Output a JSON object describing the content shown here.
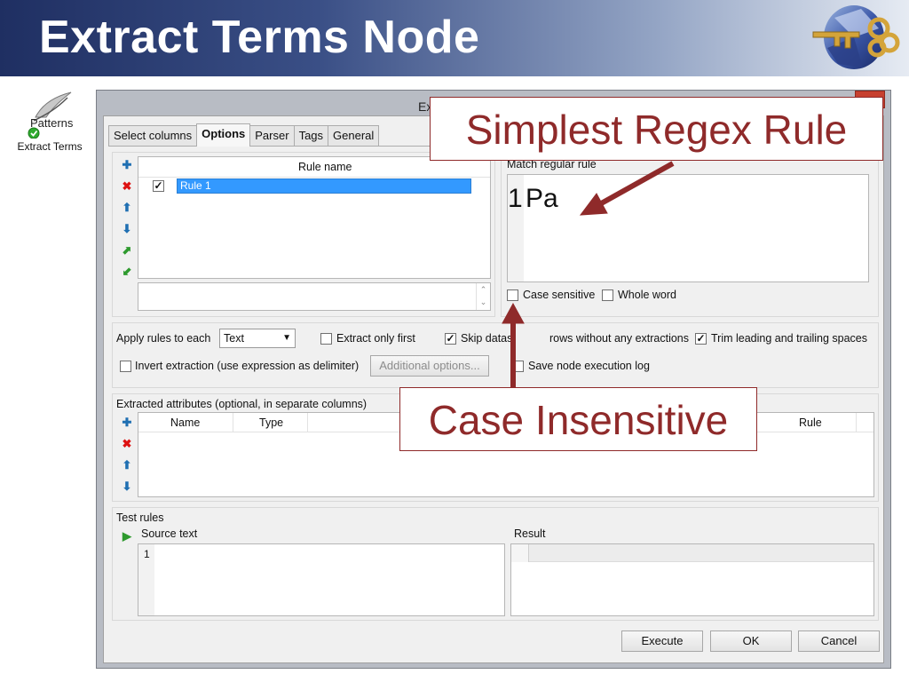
{
  "slide": {
    "title": "Extract Terms Node"
  },
  "node": {
    "label": "Extract Terms",
    "logo_text": "Patterns"
  },
  "dialog": {
    "title": "Ex",
    "tabs": [
      {
        "label": "Select columns"
      },
      {
        "label": "Options"
      },
      {
        "label": "Parser"
      },
      {
        "label": "Tags"
      },
      {
        "label": "General"
      }
    ],
    "rules": {
      "column_header": "Rule name",
      "rows": [
        {
          "name": "Rule 1",
          "checked": true
        }
      ]
    },
    "match": {
      "label": "Match regular rule",
      "line_number": "1",
      "code": "Pa",
      "case_sensitive_label": "Case sensitive",
      "whole_word_label": "Whole word"
    },
    "options": {
      "apply_label": "Apply rules to each",
      "apply_value": "Text",
      "extract_first_label": "Extract only first",
      "skip_label": "Skip datas",
      "skip_label_tail": "rows without any extractions",
      "trim_label": "Trim leading and trailing spaces",
      "invert_label": "Invert extraction (use expression as delimiter)",
      "additional_label": "Additional options...",
      "save_log_label": "Save node execution log"
    },
    "attributes": {
      "label": "Extracted attributes (optional, in separate columns)",
      "headers": {
        "name": "Name",
        "type": "Type",
        "rule": "Rule"
      }
    },
    "test": {
      "label": "Test rules",
      "source_label": "Source text",
      "source_line": "1",
      "result_label": "Result"
    },
    "buttons": {
      "execute": "Execute",
      "ok": "OK",
      "cancel": "Cancel"
    }
  },
  "callouts": {
    "regex": "Simplest Regex Rule",
    "case": "Case Insensitive"
  },
  "colors": {
    "callout": "#8f2a2a",
    "selection": "#3399ff",
    "header_dark": "#1f2f62"
  }
}
